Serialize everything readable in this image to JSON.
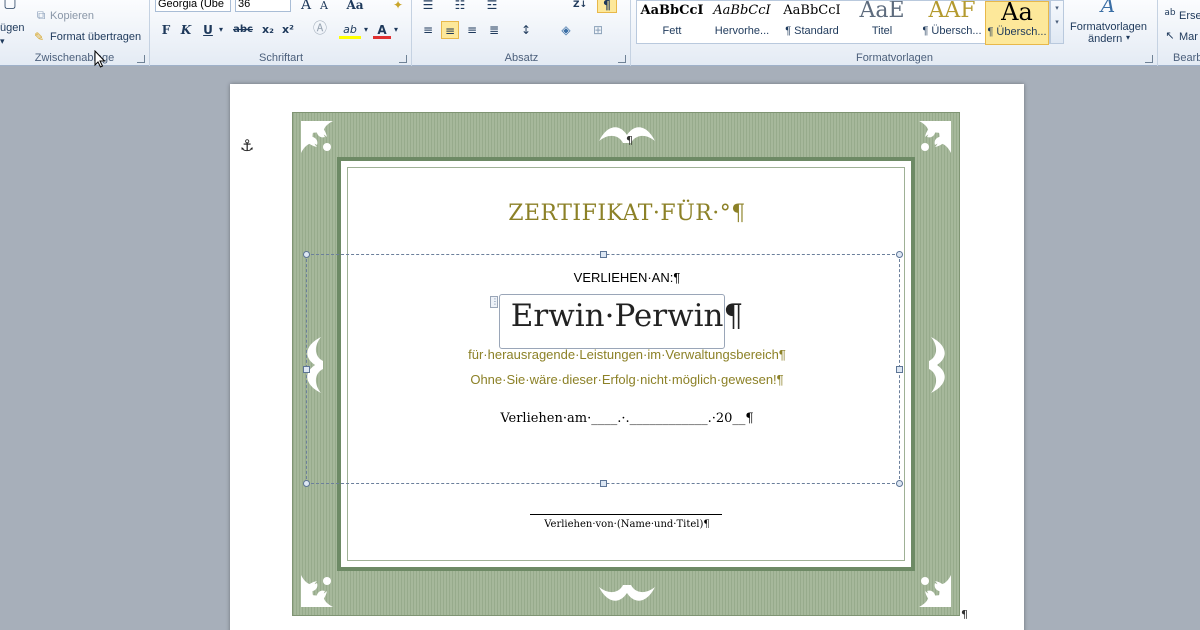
{
  "ribbon": {
    "clipboard": {
      "paste_label": "ügen",
      "copy_label": "Kopieren",
      "format_painter_label": "Format übertragen",
      "group_label": "Zwischenablage"
    },
    "font": {
      "font_name": "Georgia (Übe",
      "font_size": "36",
      "grow_label": "A",
      "shrink_label": "A",
      "case_label": "Aa",
      "bold_label": "F",
      "italic_label": "K",
      "underline_label": "U",
      "strike_label": "abc",
      "subscript_label": "x₂",
      "superscript_label": "x²",
      "highlight_label": "ab",
      "color_label": "A",
      "group_label": "Schriftart"
    },
    "paragraph": {
      "group_label": "Absatz",
      "pilcrow_label": "¶",
      "sort_label": "Z↓"
    },
    "styles": {
      "group_label": "Formatvorlagen",
      "tiles": [
        {
          "sample": "AaBbCcI",
          "name": "Fett"
        },
        {
          "sample": "AaBbCcI",
          "name": "Hervorhe..."
        },
        {
          "sample": "AaBbCcI",
          "name": "¶ Standard"
        },
        {
          "sample": "AaE",
          "name": "Titel"
        },
        {
          "sample": "AAF",
          "name": "¶ Übersch..."
        },
        {
          "sample": "Aa",
          "name": "¶ Übersch..."
        }
      ],
      "change_styles_label": "Formatvorlagen",
      "change_styles_label2": "ändern",
      "change_styles_icon_label": "A"
    },
    "editing": {
      "replace_label": "Erse",
      "select_label": "Mar",
      "group_label": "Bearb"
    }
  },
  "document": {
    "title": "ZERTIFIKAT·FÜR·°¶",
    "awarded_to": "VERLIEHEN·AN:¶",
    "recipient": "Erwin·Perwin¶",
    "line1": "für·herausragende·Leistungen·im·Verwaltungsbereich¶",
    "line2": "Ohne·Sie·wäre·dieser·Erfolg·nicht·möglich·gewesen!¶",
    "date_line": "Verliehen·am·____.·.____________.·20__¶",
    "signer": "Verliehen·von·(Name·und·Titel)¶",
    "top_pilcrow": "¶",
    "end_pilcrow": "¶",
    "anchor_icon": "⚓"
  },
  "colors": {
    "accent_olive": "#8c8127",
    "frame_green": "#97ab8c",
    "ribbon_text": "#1e395b"
  }
}
